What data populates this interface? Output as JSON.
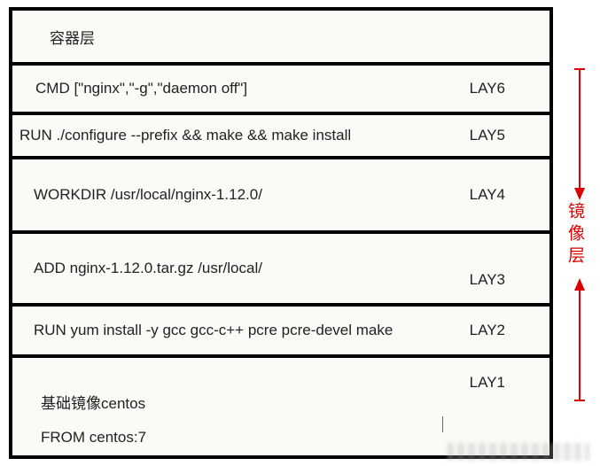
{
  "header": {
    "title": "容器层"
  },
  "layers": [
    {
      "cmd": "CMD [\"nginx\",\"-g\",\"daemon off\"]",
      "label": "LAY6"
    },
    {
      "cmd": "RUN ./configure --prefix && make && make install",
      "label": "LAY5"
    },
    {
      "cmd": "WORKDIR /usr/local/nginx-1.12.0/",
      "label": "LAY4"
    },
    {
      "cmd": "ADD nginx-1.12.0.tar.gz /usr/local/",
      "label": "LAY3"
    },
    {
      "cmd": "RUN yum install -y gcc gcc-c++ pcre pcre-devel make",
      "label": "LAY2"
    },
    {
      "cmd_line1": "基础镜像centos",
      "cmd_line2": "FROM centos:7",
      "label": "LAY1"
    }
  ],
  "annotation": {
    "arrow_label": "镜像层"
  }
}
